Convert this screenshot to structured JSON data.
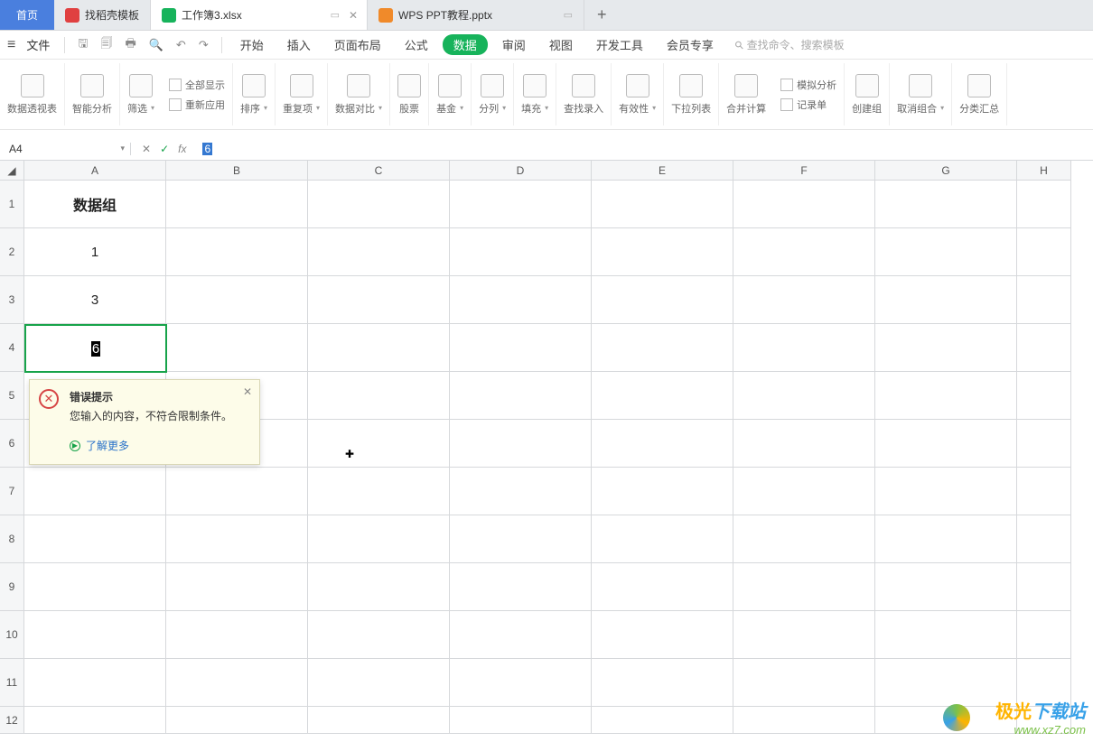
{
  "tabs": {
    "home": "首页",
    "template": "找稻壳模板",
    "active": "工作簿3.xlsx",
    "ppt": "WPS PPT教程.pptx"
  },
  "menu": {
    "file": "文件",
    "items": [
      "开始",
      "插入",
      "页面布局",
      "公式",
      "数据",
      "审阅",
      "视图",
      "开发工具",
      "会员专享"
    ],
    "active_index": 4,
    "search_placeholder": "查找命令、搜索模板"
  },
  "ribbon": {
    "g0": "数据透视表",
    "g1": "智能分析",
    "g2": "筛选",
    "g2a": "全部显示",
    "g2b": "重新应用",
    "g3": "排序",
    "g4": "重复项",
    "g5": "数据对比",
    "g6": "股票",
    "g7": "基金",
    "g8": "分列",
    "g9": "填充",
    "g10": "查找录入",
    "g11": "有效性",
    "g12": "下拉列表",
    "g13": "合并计算",
    "g14": "模拟分析",
    "g15": "记录单",
    "g16": "创建组",
    "g17": "取消组合",
    "g18": "分类汇总"
  },
  "formula": {
    "namebox": "A4",
    "value": "6"
  },
  "cols": [
    "A",
    "B",
    "C",
    "D",
    "E",
    "F",
    "G",
    "H"
  ],
  "rows": [
    "1",
    "2",
    "3",
    "4",
    "5",
    "6",
    "7",
    "8",
    "9",
    "10",
    "11",
    "12"
  ],
  "cells": {
    "A1": "数据组",
    "A2": "1",
    "A3": "3",
    "A4": "6"
  },
  "error": {
    "title": "错误提示",
    "msg": "您输入的内容，不符合限制条件。",
    "more": "了解更多"
  },
  "watermark": {
    "l1a": "极光",
    "l1b": "下载站",
    "l2": "www.xz7.com"
  }
}
